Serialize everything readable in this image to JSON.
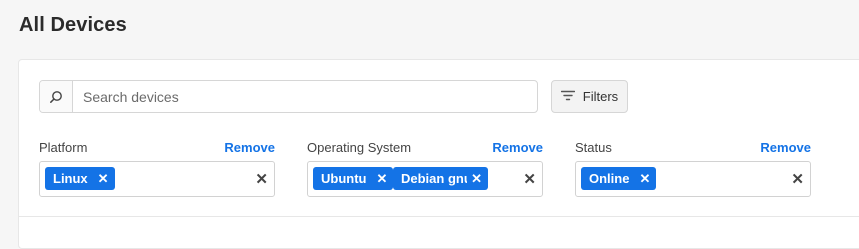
{
  "page": {
    "title": "All Devices"
  },
  "search": {
    "placeholder": "Search devices",
    "value": ""
  },
  "toolbar": {
    "filters_label": "Filters"
  },
  "filters": {
    "platform": {
      "label": "Platform",
      "remove_label": "Remove",
      "chips": [
        "Linux"
      ]
    },
    "os": {
      "label": "Operating System",
      "remove_label": "Remove",
      "chips": [
        "Ubuntu",
        "Debian gnu/l"
      ]
    },
    "status": {
      "label": "Status",
      "remove_label": "Remove",
      "chips": [
        "Online"
      ]
    }
  },
  "icons": {
    "search": "search-icon",
    "filters": "filter-lines-icon",
    "chip_remove": "close-icon",
    "clear": "close-icon"
  },
  "colors": {
    "accent": "#1473e6",
    "background": "#f6f6f6",
    "card": "#ffffff",
    "border": "#d6d6d6"
  }
}
